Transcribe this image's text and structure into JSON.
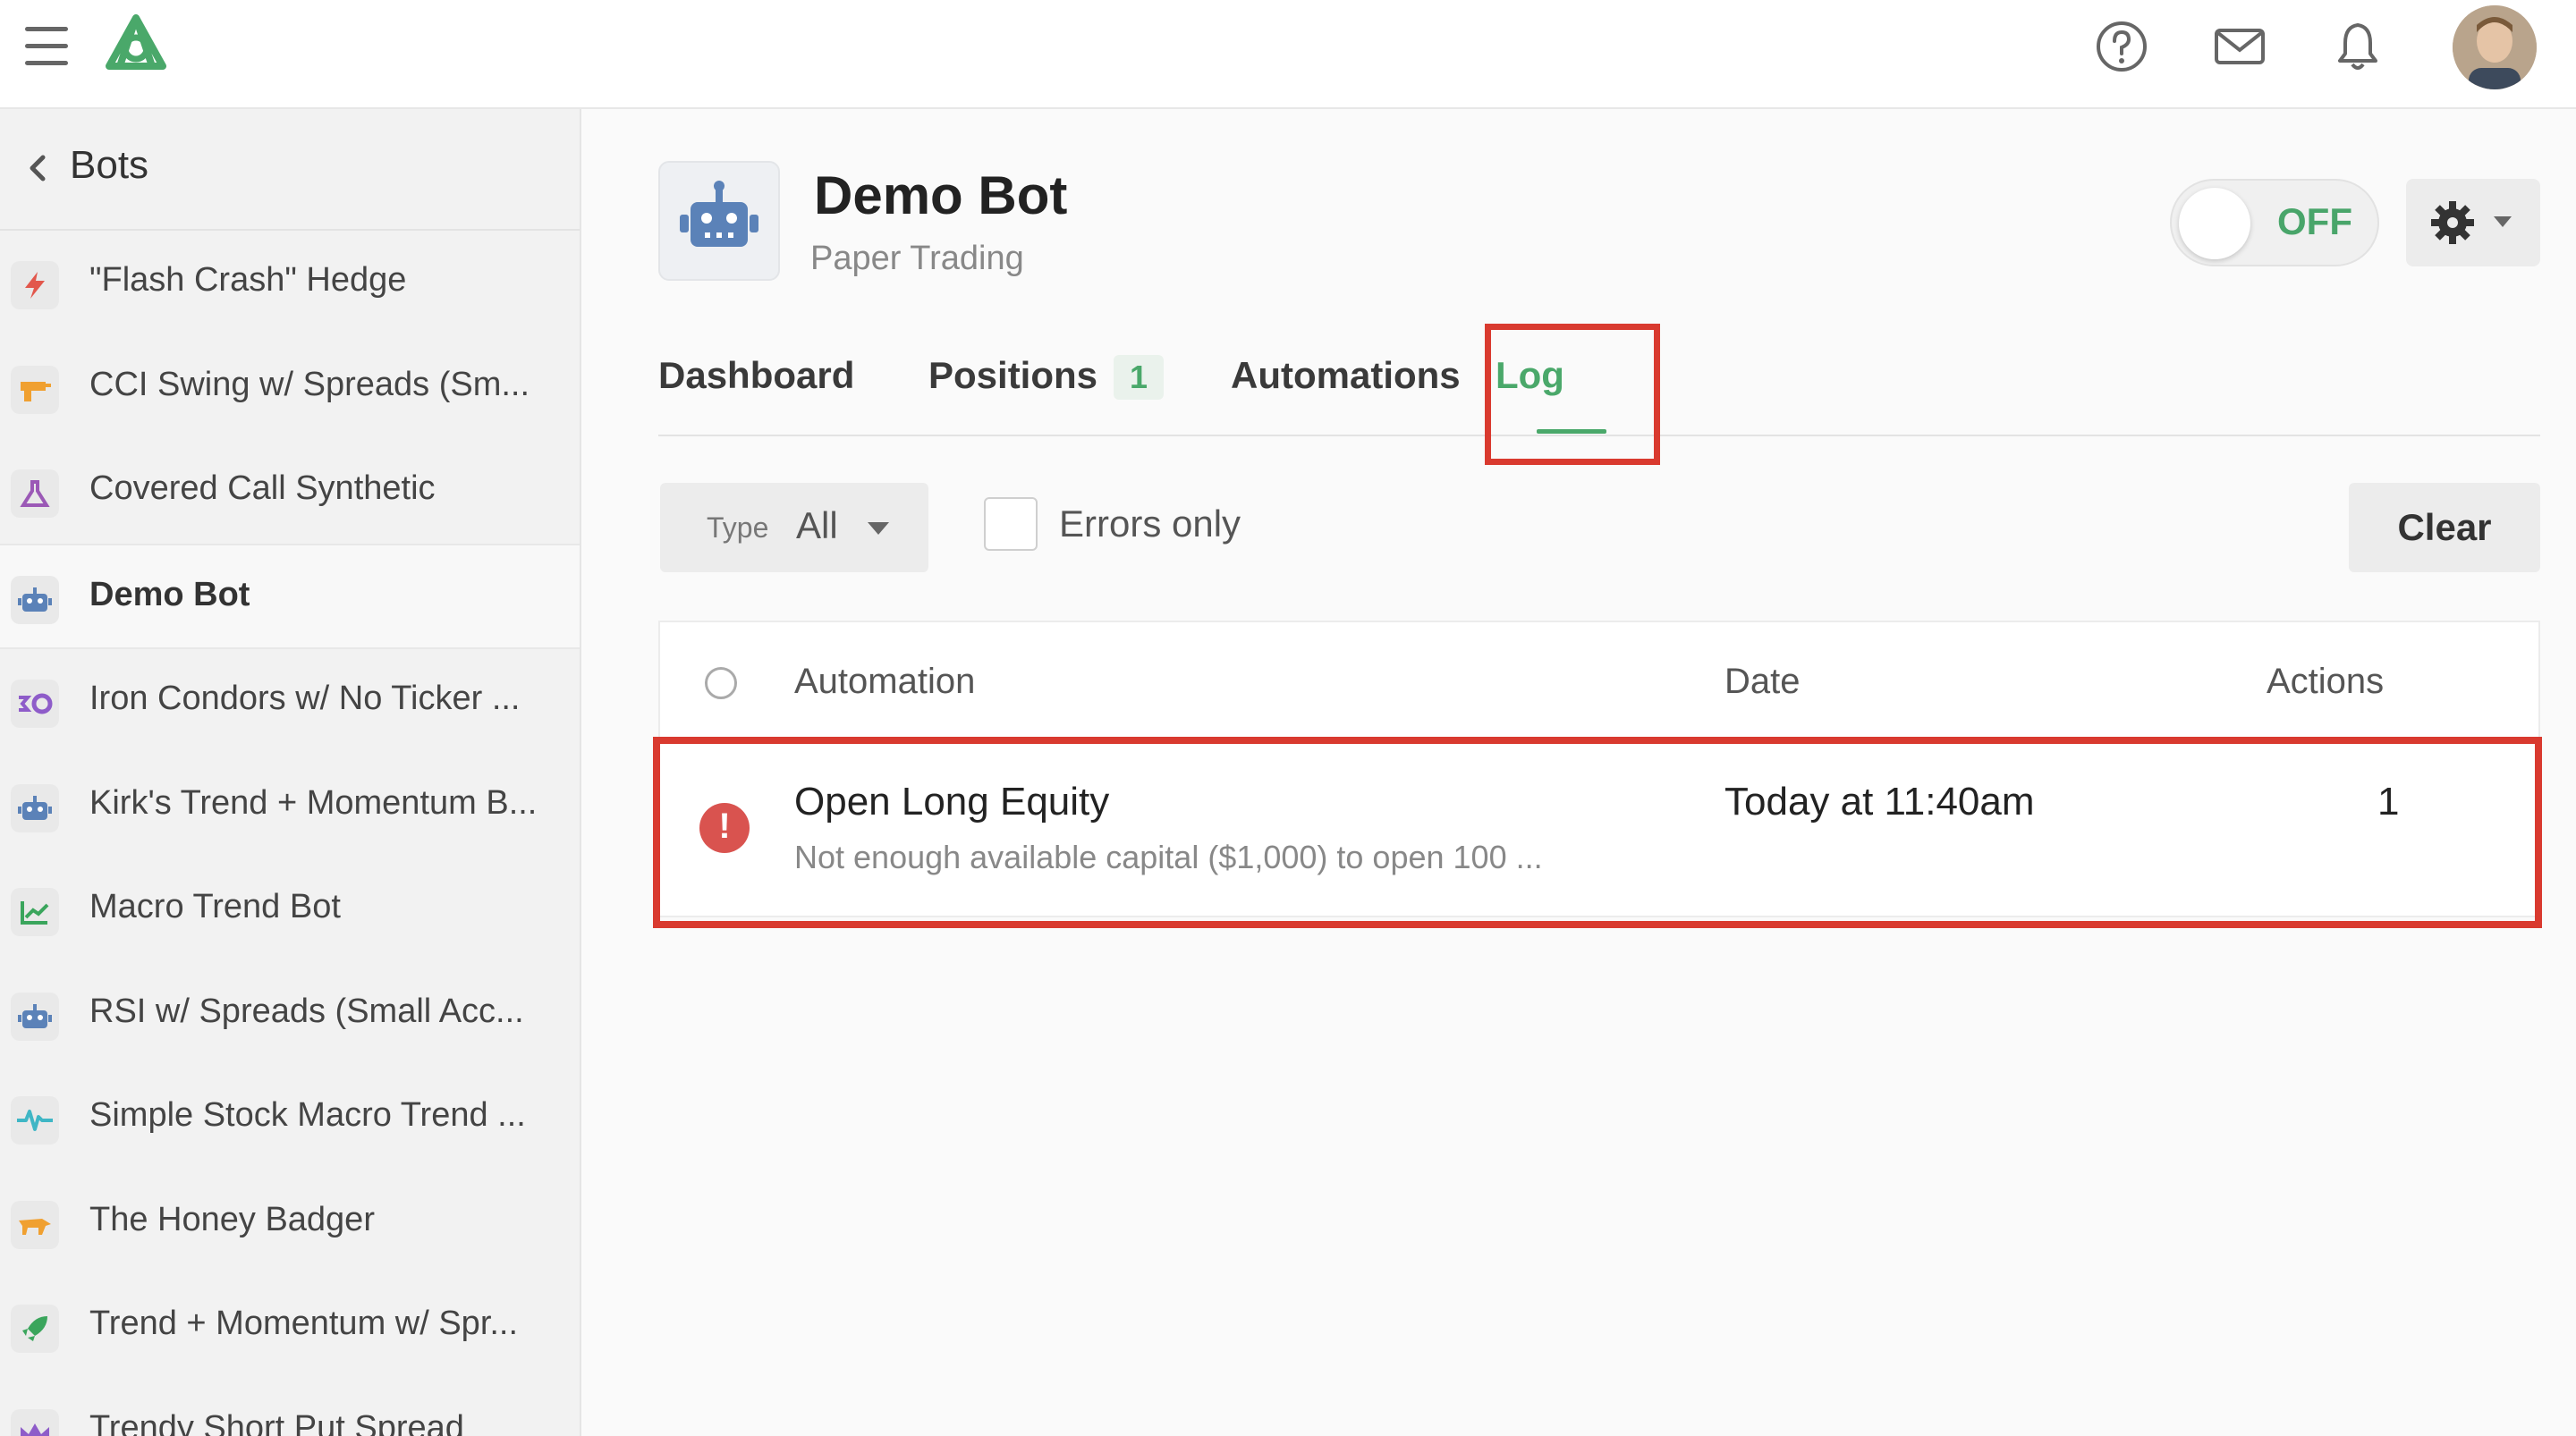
{
  "topbar": {
    "icons": [
      "menu-icon",
      "logo-icon",
      "help-icon",
      "mail-icon",
      "bell-icon",
      "avatar"
    ]
  },
  "sidebar": {
    "back_label": "Bots",
    "items": [
      {
        "label": "\"Flash Crash\" Hedge",
        "icon": "lightning-icon",
        "color": "#e2574c"
      },
      {
        "label": "CCI Swing w/ Spreads (Sm...",
        "icon": "blaster-icon",
        "color": "#f0a030"
      },
      {
        "label": "Covered Call Synthetic",
        "icon": "flask-icon",
        "color": "#9b59b6"
      },
      {
        "label": "Demo Bot",
        "icon": "robot-icon",
        "color": "#5b82b8",
        "active": true
      },
      {
        "label": "Iron Condors w/ No Ticker ...",
        "icon": "iron-condor-icon",
        "color": "#8e5cc9"
      },
      {
        "label": "Kirk's Trend + Momentum B...",
        "icon": "robot-icon",
        "color": "#5b82b8"
      },
      {
        "label": "Macro Trend Bot",
        "icon": "chart-line-icon",
        "color": "#3aa55c"
      },
      {
        "label": "RSI w/ Spreads (Small Acc...",
        "icon": "robot-icon",
        "color": "#5b82b8"
      },
      {
        "label": "Simple Stock Macro Trend ...",
        "icon": "pulse-icon",
        "color": "#3fb6c5"
      },
      {
        "label": "The Honey Badger",
        "icon": "badger-icon",
        "color": "#f0a030"
      },
      {
        "label": "Trend + Momentum w/ Spr...",
        "icon": "rocket-icon",
        "color": "#3aa55c"
      },
      {
        "label": "Trendy Short Put Spread",
        "icon": "crown-icon",
        "color": "#8e5cc9"
      }
    ]
  },
  "bot": {
    "title": "Demo Bot",
    "subtitle": "Paper Trading",
    "toggle_label": "OFF"
  },
  "tabs": [
    {
      "label": "Dashboard"
    },
    {
      "label": "Positions",
      "badge": "1"
    },
    {
      "label": "Automations"
    },
    {
      "label": "Log",
      "active": true
    }
  ],
  "filters": {
    "type_key": "Type",
    "type_value": "All",
    "errors_only_label": "Errors only",
    "clear_label": "Clear"
  },
  "table": {
    "headers": [
      "Automation",
      "Date",
      "Actions"
    ],
    "rows": [
      {
        "automation": "Open Long Equity",
        "detail": "Not enough available capital ($1,000) to open 100 ...",
        "date": "Today at 11:40am",
        "actions": "1",
        "status": "error"
      }
    ]
  },
  "colors": {
    "accent": "#4aa86a",
    "highlight": "#d93a2f",
    "error": "#d9534f"
  }
}
